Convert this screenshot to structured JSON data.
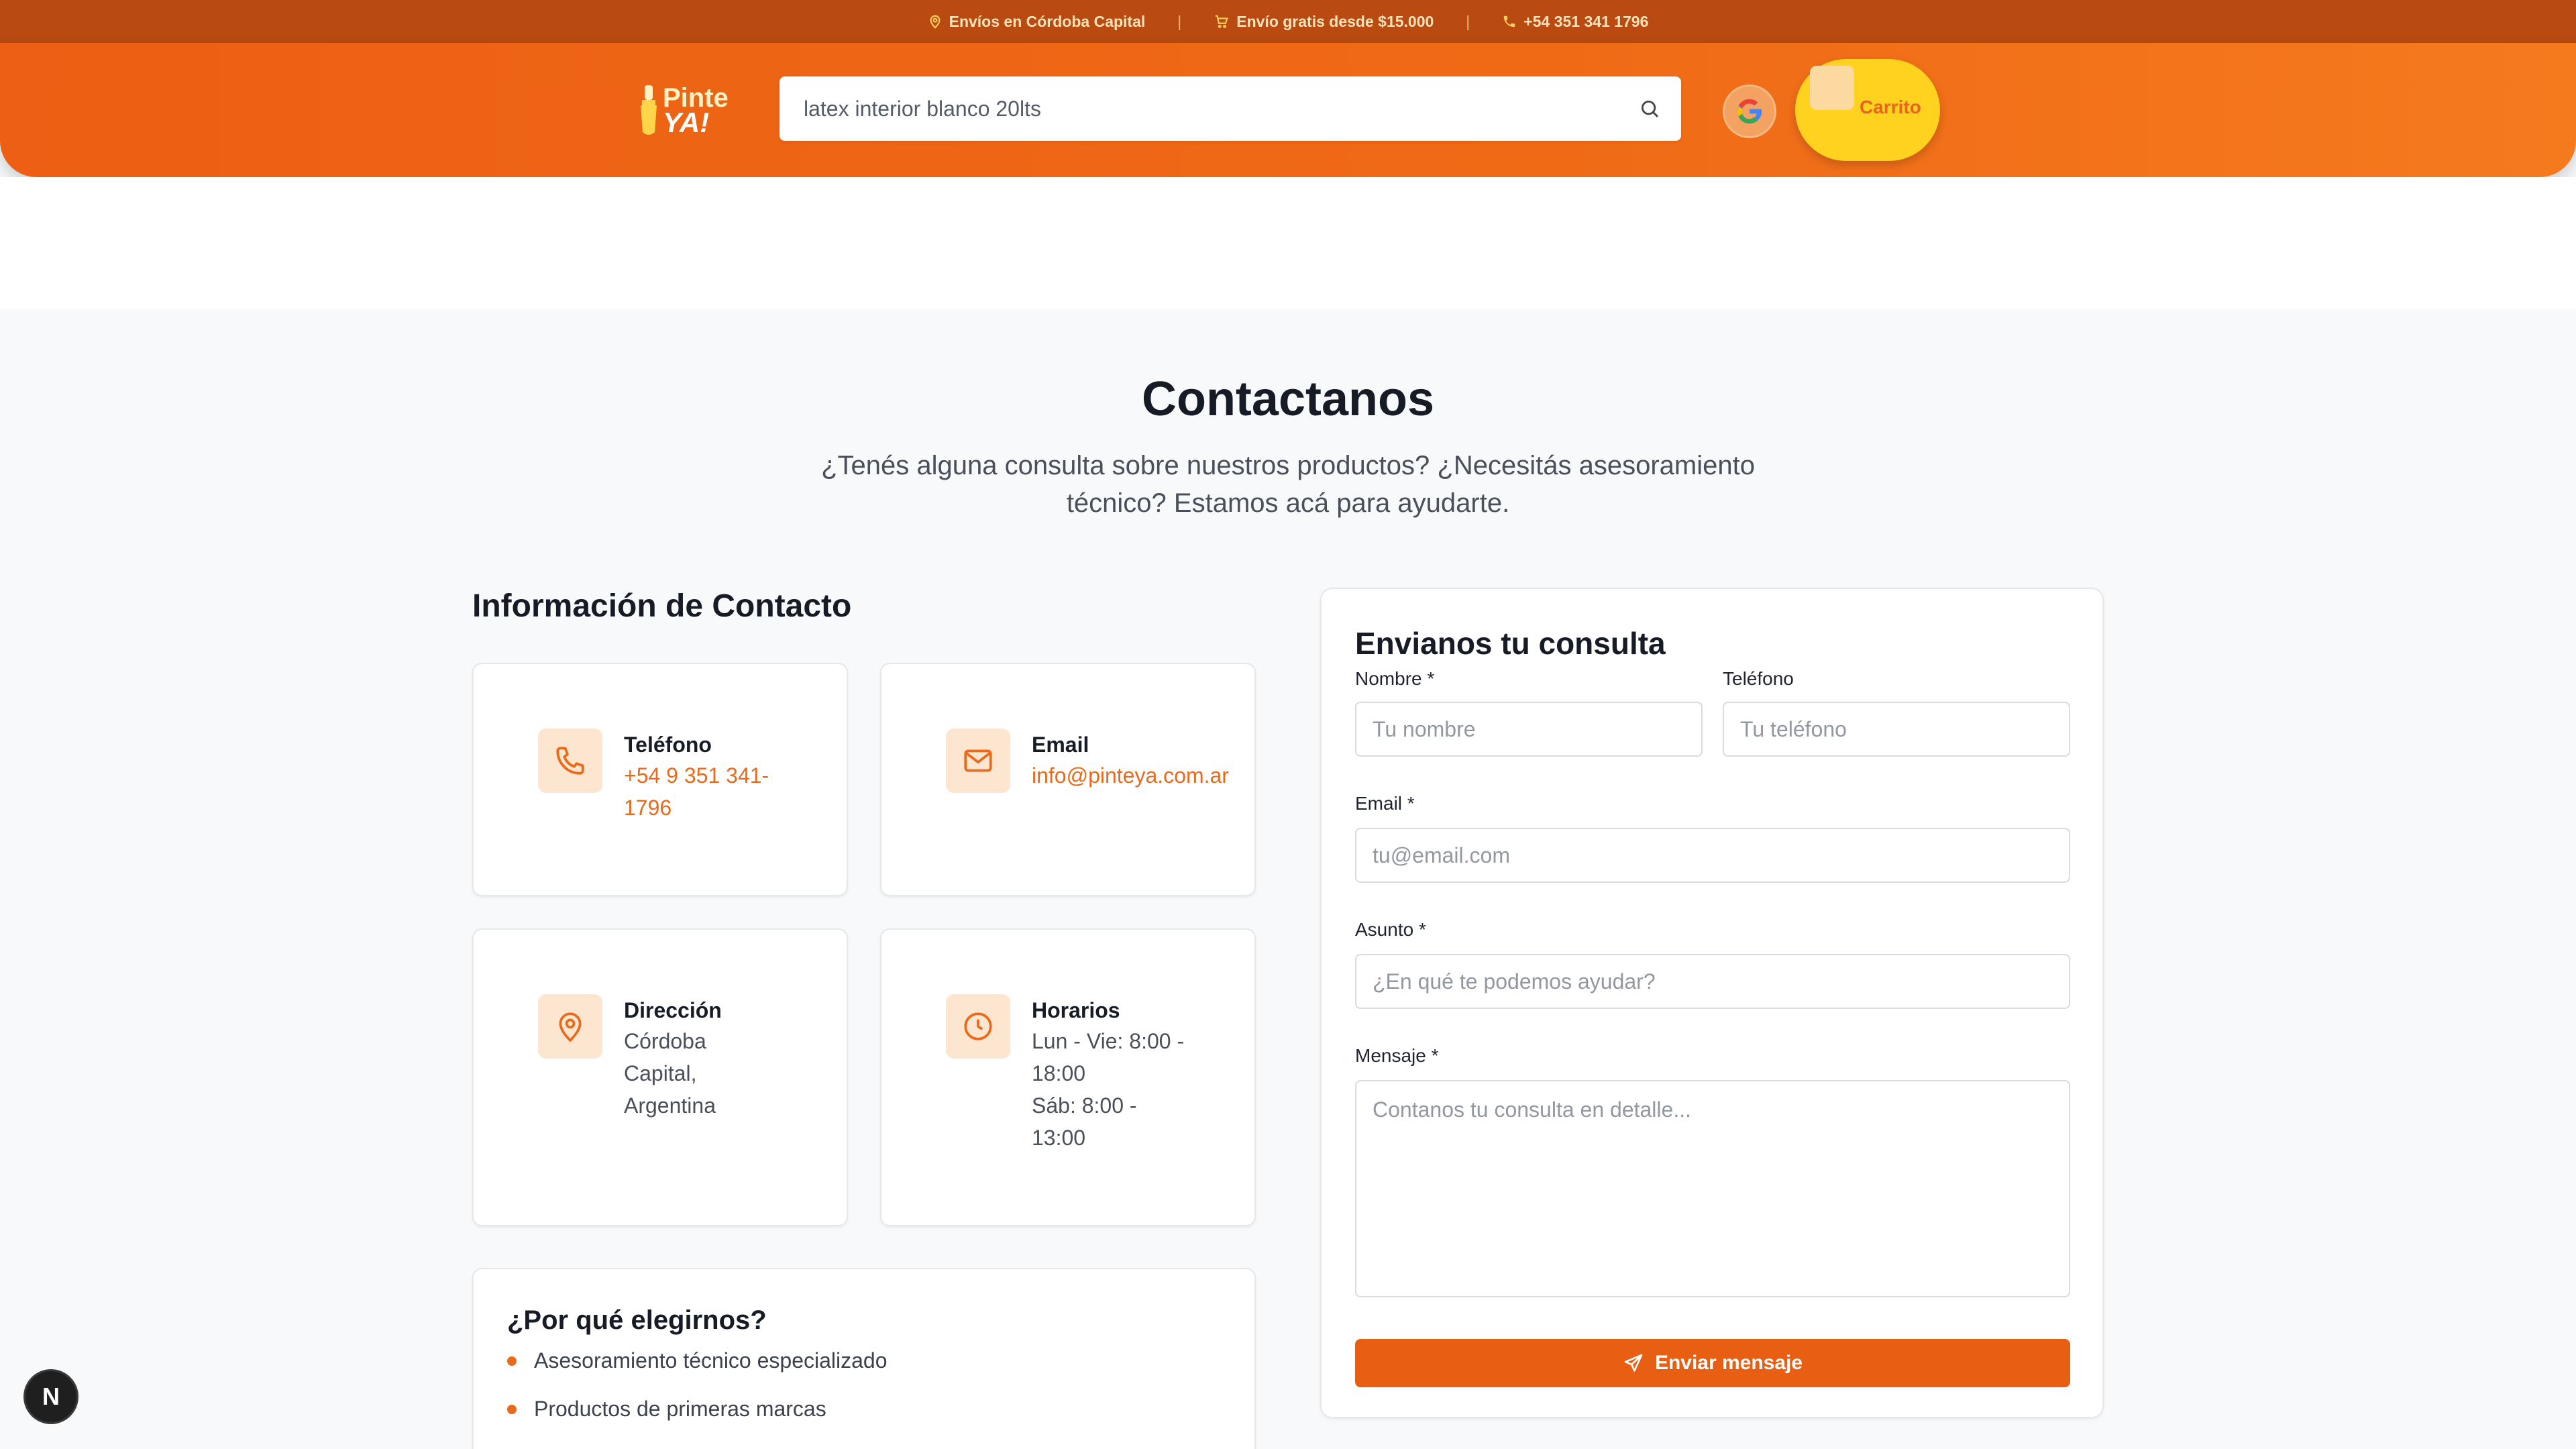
{
  "topbar": {
    "shipping": "Envíos en Córdoba Capital",
    "free_shipping": "Envío gratis desde $15.000",
    "phone": "+54 351 341 1796",
    "separator": "|"
  },
  "header": {
    "logo_line1": "Pinte",
    "logo_line2": "YA!",
    "search_value": "latex interior blanco 20lts",
    "cart_label": "Carrito"
  },
  "page": {
    "title": "Contactanos",
    "subtitle": "¿Tenés alguna consulta sobre nuestros productos? ¿Necesitás asesoramiento técnico? Estamos acá para ayudarte."
  },
  "contact_info": {
    "title": "Información de Contacto",
    "phone": {
      "title": "Teléfono",
      "value_line1": "+54 9 351 341-",
      "value_line2": "1796"
    },
    "email": {
      "title": "Email",
      "value": "info@pinteya.com.ar"
    },
    "address": {
      "title": "Dirección",
      "line1": "Córdoba",
      "line2": "Capital,",
      "line3": "Argentina"
    },
    "hours": {
      "title": "Horarios",
      "line1": "Lun - Vie: 8:00 -",
      "line2": "18:00",
      "line3": "Sáb: 8:00 -",
      "line4": "13:00"
    }
  },
  "why_us": {
    "title": "¿Por qué elegirnos?",
    "items": [
      "Asesoramiento técnico especializado",
      "Productos de primeras marcas"
    ]
  },
  "form": {
    "title": "Envianos tu consulta",
    "name_label": "Nombre *",
    "name_placeholder": "Tu nombre",
    "phone_label": "Teléfono",
    "phone_placeholder": "Tu teléfono",
    "email_label": "Email *",
    "email_placeholder": "tu@email.com",
    "subject_label": "Asunto *",
    "subject_placeholder": "¿En qué te podemos ayudar?",
    "message_label": "Mensaje *",
    "message_placeholder": "Contanos tu consulta en detalle...",
    "submit_label": "Enviar mensaje"
  },
  "dev_badge": {
    "letter": "N"
  },
  "colors": {
    "brand_orange": "#ea6a1c",
    "topbar_brown": "#b94a12",
    "cart_yellow": "#ffd21f",
    "icon_bg": "#fde6cf"
  },
  "icons": [
    "map-pin-icon",
    "cart-icon",
    "phone-icon",
    "search-icon",
    "google-icon",
    "mail-icon",
    "clock-icon",
    "send-icon"
  ]
}
